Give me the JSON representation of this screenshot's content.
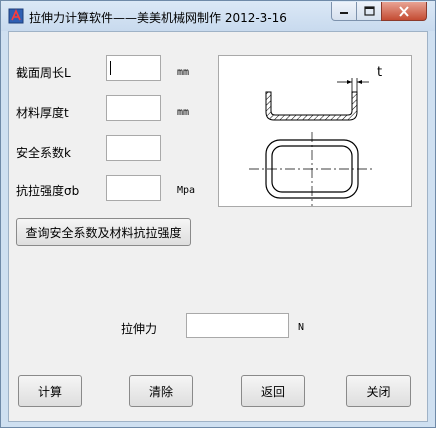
{
  "window": {
    "title": "拉伸力计算软件——美美机械网制作  2012-3-16",
    "controls": {
      "minimize": "minimize-icon",
      "maximize": "maximize-icon",
      "close": "close-icon"
    }
  },
  "form": {
    "perimeter": {
      "label": "截面周长L",
      "value": "",
      "unit": "mm"
    },
    "thickness": {
      "label": "材料厚度t",
      "value": "",
      "unit": "mm"
    },
    "safety_factor": {
      "label": "安全系数k",
      "value": ""
    },
    "tensile_strength": {
      "label": "抗拉强度σb",
      "value": "",
      "unit": "Mpa"
    }
  },
  "lookup_button": "查询安全系数及材料抗拉强度",
  "result": {
    "label": "拉伸力",
    "value": "",
    "unit": "N"
  },
  "diagram": {
    "dimension_label": "t"
  },
  "buttons": {
    "calculate": "计算",
    "clear": "清除",
    "back": "返回",
    "close": "关闭"
  },
  "colors": {
    "title_bar": "#cfe0f1",
    "close_button": "#c44c33",
    "client_bg": "#f0f0f0"
  }
}
